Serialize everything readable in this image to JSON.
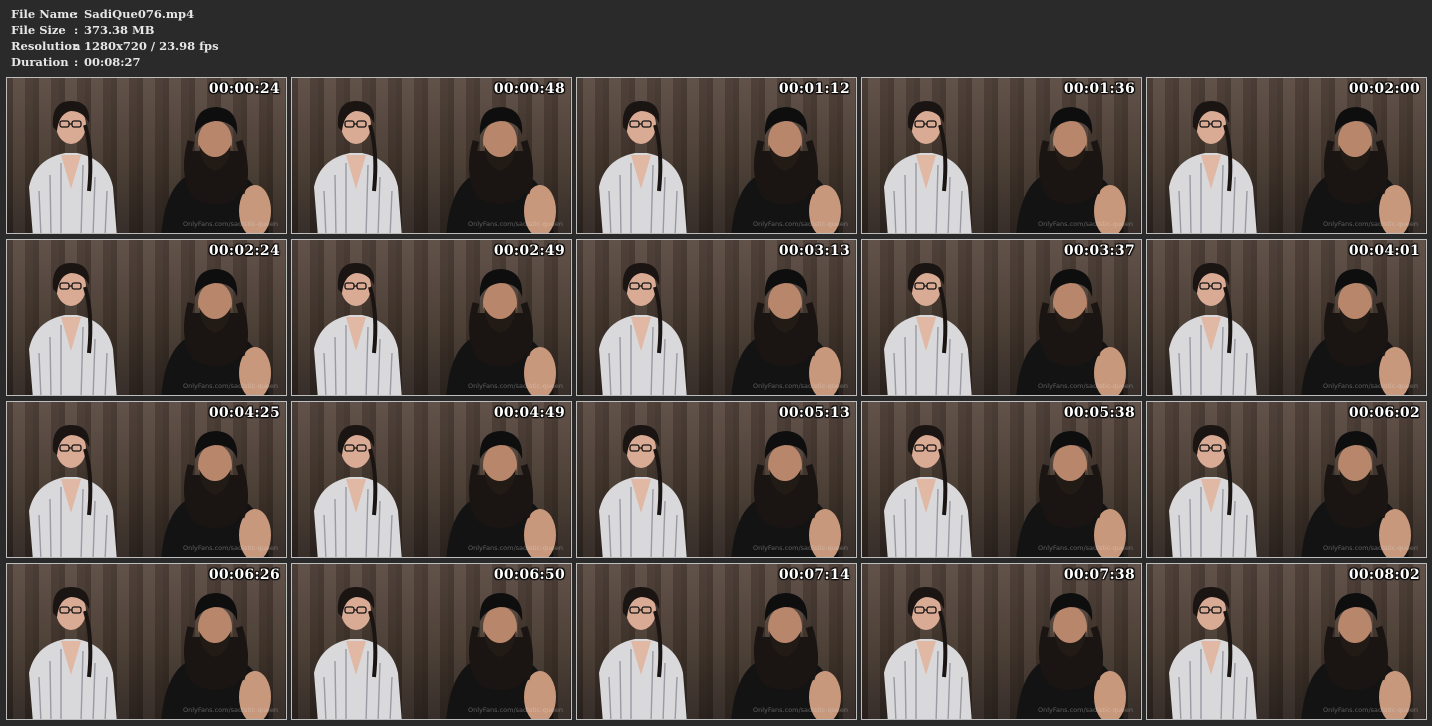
{
  "file_info": {
    "rows": [
      {
        "key": "File Name",
        "value": "SadiQue076.mp4"
      },
      {
        "key": "File Size",
        "value": "373.38 MB"
      },
      {
        "key": "Resolution",
        "value": "1280x720 / 23.98 fps"
      },
      {
        "key": "Duration",
        "value": "00:08:27"
      }
    ],
    "separator": ":"
  },
  "watermark": "OnlyFans.com/sadistic-queen",
  "thumbnails": [
    {
      "time": "00:00:24"
    },
    {
      "time": "00:00:48"
    },
    {
      "time": "00:01:12"
    },
    {
      "time": "00:01:36"
    },
    {
      "time": "00:02:00"
    },
    {
      "time": "00:02:24"
    },
    {
      "time": "00:02:49"
    },
    {
      "time": "00:03:13"
    },
    {
      "time": "00:03:37"
    },
    {
      "time": "00:04:01"
    },
    {
      "time": "00:04:25"
    },
    {
      "time": "00:04:49"
    },
    {
      "time": "00:05:13"
    },
    {
      "time": "00:05:38"
    },
    {
      "time": "00:06:02"
    },
    {
      "time": "00:06:26"
    },
    {
      "time": "00:06:50"
    },
    {
      "time": "00:07:14"
    },
    {
      "time": "00:07:38"
    },
    {
      "time": "00:08:02"
    }
  ]
}
